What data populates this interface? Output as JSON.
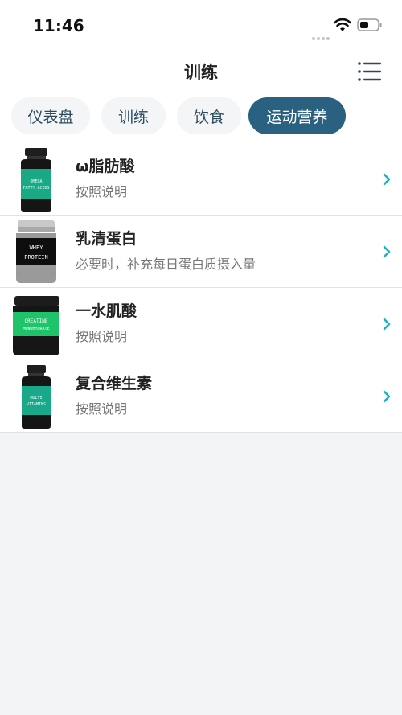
{
  "status_bar": {
    "time": "11:46"
  },
  "header": {
    "title": "训练",
    "menu_icon": "list-menu-icon"
  },
  "tabs": [
    {
      "label": "仪表盘",
      "active": false
    },
    {
      "label": "训练",
      "active": false
    },
    {
      "label": "饮食",
      "active": false
    },
    {
      "label": "运动营养",
      "active": true
    }
  ],
  "colors": {
    "accent": "#2a6080",
    "chevron": "#1fb3c0",
    "background": "#f2f4f5"
  },
  "supplements": [
    {
      "name": "ω脂肪酸",
      "dose": "按照说明",
      "label_text": "OMEGA FATTY ACIDS",
      "icon": "omega-bottle-icon",
      "label_color": "#1aa985"
    },
    {
      "name": "乳清蛋白",
      "dose": "必要时，补充每日蛋白质摄入量",
      "label_text": "WHEY PROTEIN",
      "icon": "whey-tub-icon",
      "label_color": "#111111"
    },
    {
      "name": "一水肌酸",
      "dose": "按照说明",
      "label_text": "CREATINE MONOHYDRATE",
      "icon": "creatine-tub-icon",
      "label_color": "#1ec46a"
    },
    {
      "name": "复合维生素",
      "dose": "按照说明",
      "label_text": "MULTI VITAMINS",
      "icon": "vitamin-bottle-icon",
      "label_color": "#19a98a"
    }
  ]
}
